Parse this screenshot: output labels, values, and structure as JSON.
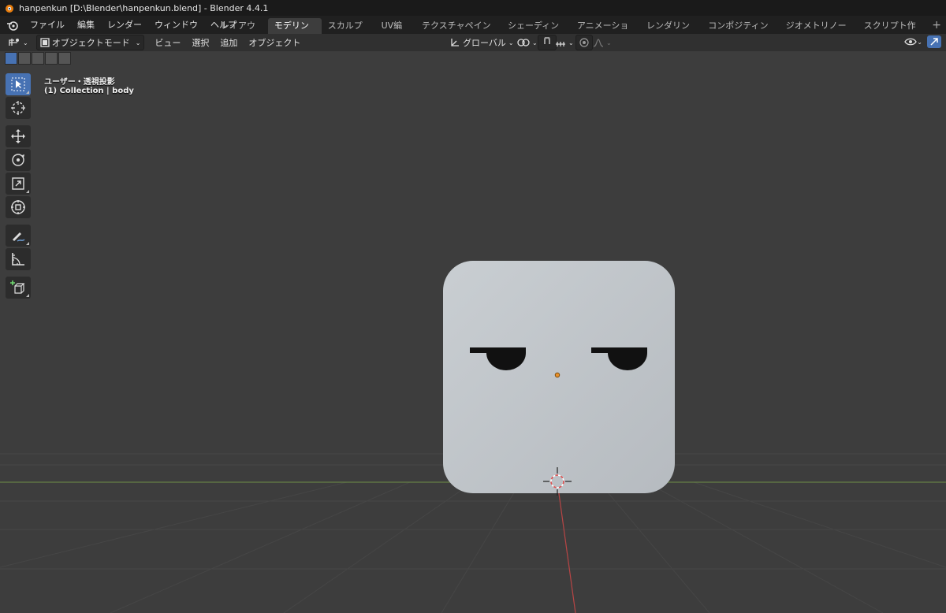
{
  "window": {
    "title": "hanpenkun [D:\\Blender\\hanpenkun.blend] - Blender 4.4.1"
  },
  "menu": [
    "ファイル",
    "編集",
    "レンダー",
    "ウィンドウ",
    "ヘルプ"
  ],
  "workspaces": [
    {
      "label": "レイアウト",
      "active": false
    },
    {
      "label": "モデリング",
      "active": true
    },
    {
      "label": "スカルプト",
      "active": false
    },
    {
      "label": "UV編集",
      "active": false
    },
    {
      "label": "テクスチャペイント",
      "active": false
    },
    {
      "label": "シェーディング",
      "active": false
    },
    {
      "label": "アニメーション",
      "active": false
    },
    {
      "label": "レンダリング",
      "active": false
    },
    {
      "label": "コンポジティング",
      "active": false
    },
    {
      "label": "ジオメトリノード",
      "active": false
    },
    {
      "label": "スクリプト作成",
      "active": false
    }
  ],
  "header": {
    "mode": "オブジェクトモード",
    "menus": [
      "ビュー",
      "選択",
      "追加",
      "オブジェクト"
    ],
    "transform_orientation": "グローバル"
  },
  "viewport": {
    "view_name": "ユーザー・透視投影",
    "collection_info": "(1) Collection | body"
  },
  "tools": [
    {
      "name": "select-box-tool",
      "icon": "cursor-select-icon",
      "active": true
    },
    {
      "name": "cursor-tool",
      "icon": "3d-cursor-icon",
      "active": false
    },
    {
      "name": "move-tool",
      "icon": "move-icon",
      "active": false
    },
    {
      "name": "rotate-tool",
      "icon": "rotate-icon",
      "active": false
    },
    {
      "name": "scale-tool",
      "icon": "scale-icon",
      "active": false
    },
    {
      "name": "transform-tool",
      "icon": "transform-icon",
      "active": false
    },
    {
      "name": "annotate-tool",
      "icon": "annotate-icon",
      "active": false
    },
    {
      "name": "measure-tool",
      "icon": "measure-icon",
      "active": false
    },
    {
      "name": "add-cube-tool",
      "icon": "add-cube-icon",
      "active": false
    }
  ],
  "colors": {
    "accent": "#4772b3",
    "viewport_bg": "#3d3d3d",
    "grid": "#4a4a4a",
    "x_axis": "#c04848",
    "y_axis": "#7aa14a",
    "object": "#c3c8cc"
  }
}
